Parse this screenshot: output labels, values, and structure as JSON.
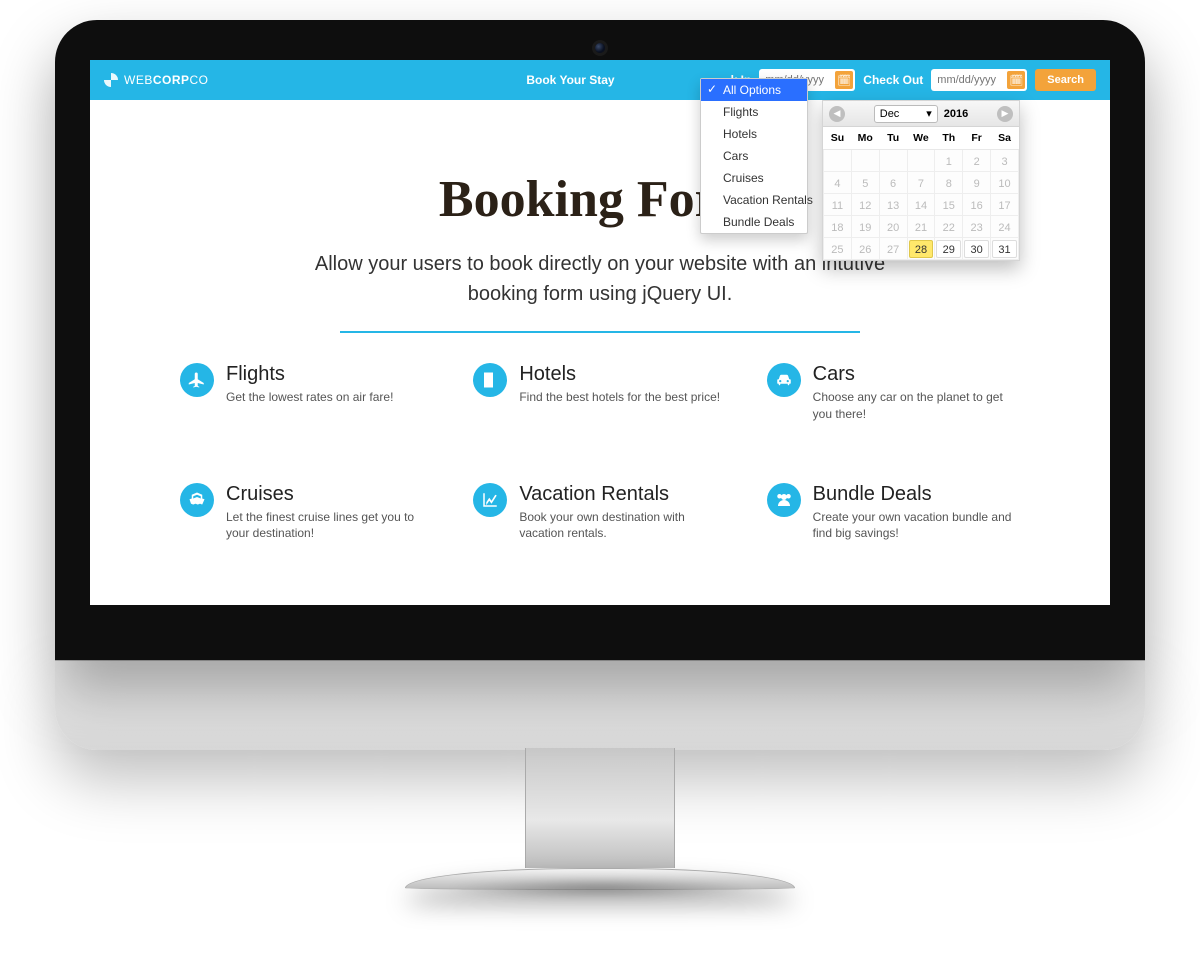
{
  "brand": {
    "prefix": "WEB",
    "bold": "CORP",
    "suffix": "CO"
  },
  "nav": {
    "book_label": "Book Your Stay",
    "checkin_label": "k In",
    "checkout_label": "Check Out",
    "date_placeholder": "mm/dd/yyyy",
    "search_label": "Search"
  },
  "dropdown": {
    "options": [
      "All Options",
      "Flights",
      "Hotels",
      "Cars",
      "Cruises",
      "Vacation Rentals",
      "Bundle Deals"
    ],
    "selected": "All Options"
  },
  "datepicker": {
    "month": "Dec",
    "year": "2016",
    "dow": [
      "Su",
      "Mo",
      "Tu",
      "We",
      "Th",
      "Fr",
      "Sa"
    ],
    "weeks": [
      [
        {
          "n": "",
          "s": "blank"
        },
        {
          "n": "",
          "s": "blank"
        },
        {
          "n": "",
          "s": "blank"
        },
        {
          "n": "",
          "s": "blank"
        },
        {
          "n": "1",
          "s": "dis"
        },
        {
          "n": "2",
          "s": "dis"
        },
        {
          "n": "3",
          "s": "dis"
        }
      ],
      [
        {
          "n": "4",
          "s": "dis"
        },
        {
          "n": "5",
          "s": "dis"
        },
        {
          "n": "6",
          "s": "dis"
        },
        {
          "n": "7",
          "s": "dis"
        },
        {
          "n": "8",
          "s": "dis"
        },
        {
          "n": "9",
          "s": "dis"
        },
        {
          "n": "10",
          "s": "dis"
        }
      ],
      [
        {
          "n": "11",
          "s": "dis"
        },
        {
          "n": "12",
          "s": "dis"
        },
        {
          "n": "13",
          "s": "dis"
        },
        {
          "n": "14",
          "s": "dis"
        },
        {
          "n": "15",
          "s": "dis"
        },
        {
          "n": "16",
          "s": "dis"
        },
        {
          "n": "17",
          "s": "dis"
        }
      ],
      [
        {
          "n": "18",
          "s": "dis"
        },
        {
          "n": "19",
          "s": "dis"
        },
        {
          "n": "20",
          "s": "dis"
        },
        {
          "n": "21",
          "s": "dis"
        },
        {
          "n": "22",
          "s": "dis"
        },
        {
          "n": "23",
          "s": "dis"
        },
        {
          "n": "24",
          "s": "dis"
        }
      ],
      [
        {
          "n": "25",
          "s": "dis"
        },
        {
          "n": "26",
          "s": "dis"
        },
        {
          "n": "27",
          "s": "dis"
        },
        {
          "n": "28",
          "s": "today"
        },
        {
          "n": "29",
          "s": "avail"
        },
        {
          "n": "30",
          "s": "avail"
        },
        {
          "n": "31",
          "s": "avail"
        }
      ]
    ]
  },
  "hero": {
    "title": "Booking Form",
    "subtitle": "Allow your users to book directly on your website with an intutive booking form using jQuery UI."
  },
  "features": [
    {
      "icon": "plane",
      "title": "Flights",
      "desc": "Get the lowest rates on air fare!"
    },
    {
      "icon": "building",
      "title": "Hotels",
      "desc": "Find the best hotels for the best price!"
    },
    {
      "icon": "car",
      "title": "Cars",
      "desc": "Choose any car on the planet to get you there!"
    },
    {
      "icon": "ship",
      "title": "Cruises",
      "desc": "Let the finest cruise lines get you to your destination!"
    },
    {
      "icon": "chart",
      "title": "Vacation Rentals",
      "desc": "Book your own destination with vacation rentals."
    },
    {
      "icon": "users",
      "title": "Bundle Deals",
      "desc": "Create your own vacation bundle and find big savings!"
    }
  ]
}
